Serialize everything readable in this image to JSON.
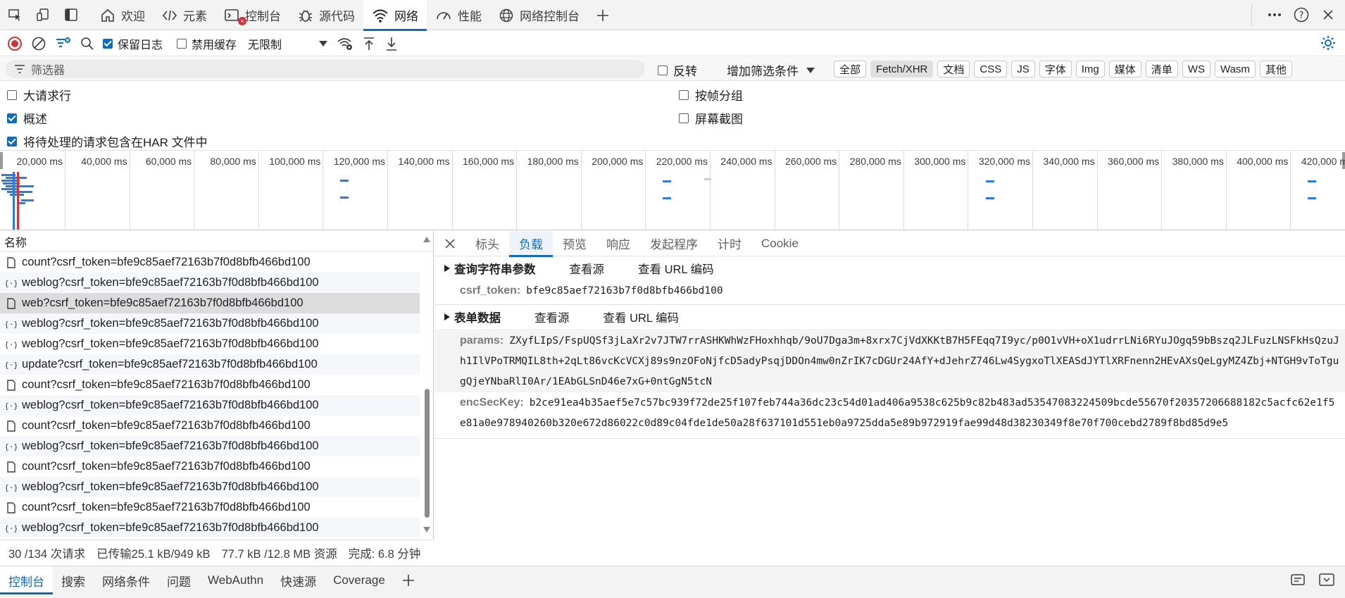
{
  "tabs": [
    {
      "label": "欢迎",
      "icon": "home-icon"
    },
    {
      "label": "元素",
      "icon": "code-icon"
    },
    {
      "label": "控制台",
      "icon": "console-icon",
      "badge": "×"
    },
    {
      "label": "源代码",
      "icon": "bug-icon"
    },
    {
      "label": "网络",
      "icon": "wifi-icon",
      "active": true
    },
    {
      "label": "性能",
      "icon": "gauge-icon"
    },
    {
      "label": "网络控制台",
      "icon": "globe-icon"
    }
  ],
  "toolbar": {
    "preserve_log": "保留日志",
    "disable_cache": "禁用缓存",
    "throttle": "无限制"
  },
  "filter": {
    "placeholder": "筛选器",
    "invert": "反转",
    "add_filter": "增加筛选条件",
    "types": [
      "全部",
      "Fetch/XHR",
      "文档",
      "CSS",
      "JS",
      "字体",
      "Img",
      "媒体",
      "清单",
      "WS",
      "Wasm",
      "其他"
    ]
  },
  "options": {
    "big_rows": "大请求行",
    "overview": "概述",
    "har_pending": "将待处理的请求包含在HAR 文件中",
    "group_by_frame": "按帧分组",
    "screenshots": "屏幕截图"
  },
  "timeline": {
    "ticks": [
      "20,000 ms",
      "40,000 ms",
      "60,000 ms",
      "80,000 ms",
      "100,000 ms",
      "120,000 ms",
      "140,000 ms",
      "160,000 ms",
      "180,000 ms",
      "200,000 ms",
      "220,000 ms",
      "240,000 ms",
      "260,000 ms",
      "280,000 ms",
      "300,000 ms",
      "320,000 ms",
      "340,000 ms",
      "360,000 ms",
      "380,000 ms",
      "400,000 ms",
      "420,000 ms"
    ]
  },
  "requests": {
    "header": "名称",
    "rows": [
      {
        "name": "count?csrf_token=bfe9c85aef72163b7f0d8bfb466bd100",
        "icon": "doc-icon"
      },
      {
        "name": "weblog?csrf_token=bfe9c85aef72163b7f0d8bfb466bd100",
        "icon": "braces-icon"
      },
      {
        "name": "web?csrf_token=bfe9c85aef72163b7f0d8bfb466bd100",
        "icon": "doc-icon",
        "selected": true
      },
      {
        "name": "weblog?csrf_token=bfe9c85aef72163b7f0d8bfb466bd100",
        "icon": "braces-icon"
      },
      {
        "name": "weblog?csrf_token=bfe9c85aef72163b7f0d8bfb466bd100",
        "icon": "braces-icon"
      },
      {
        "name": "update?csrf_token=bfe9c85aef72163b7f0d8bfb466bd100",
        "icon": "braces-icon"
      },
      {
        "name": "count?csrf_token=bfe9c85aef72163b7f0d8bfb466bd100",
        "icon": "doc-icon"
      },
      {
        "name": "weblog?csrf_token=bfe9c85aef72163b7f0d8bfb466bd100",
        "icon": "braces-icon"
      },
      {
        "name": "count?csrf_token=bfe9c85aef72163b7f0d8bfb466bd100",
        "icon": "doc-icon"
      },
      {
        "name": "weblog?csrf_token=bfe9c85aef72163b7f0d8bfb466bd100",
        "icon": "braces-icon"
      },
      {
        "name": "count?csrf_token=bfe9c85aef72163b7f0d8bfb466bd100",
        "icon": "doc-icon"
      },
      {
        "name": "weblog?csrf_token=bfe9c85aef72163b7f0d8bfb466bd100",
        "icon": "braces-icon"
      },
      {
        "name": "count?csrf_token=bfe9c85aef72163b7f0d8bfb466bd100",
        "icon": "doc-icon"
      },
      {
        "name": "weblog?csrf_token=bfe9c85aef72163b7f0d8bfb466bd100",
        "icon": "braces-icon"
      }
    ]
  },
  "details": {
    "tabs": [
      "标头",
      "负载",
      "预览",
      "响应",
      "发起程序",
      "计时",
      "Cookie"
    ],
    "active_tab": "负载",
    "query": {
      "title": "查询字符串参数",
      "view_source": "查看源",
      "view_url_encoded": "查看 URL 编码",
      "key": "csrf_token:",
      "value": "bfe9c85aef72163b7f0d8bfb466bd100"
    },
    "form": {
      "title": "表单数据",
      "view_source": "查看源",
      "view_url_encoded": "查看 URL 编码",
      "params_key": "params:",
      "params_value": "ZXyfLIpS/FspUQSf3jLaXr2v7JTW7rrASHKWhWzFHoxhhqb/9oU7Dga3m+8xrx7CjVdXKKtB7H5FEqq7I9yc/p0O1vVH+oX1udrrLNi6RYuJOgq59bBszq2JLFuzLNSFkHsQzuJh1IlVPoTRMQIL8th+2qLt86vcKcVCXj89s9nzOFoNjfcD5adyPsqjDDOn4mw0nZrIK7cDGUr24AfY+dJehrZ746Lw4SygxoTlXEASdJYTlXRFnenn2HEvAXsQeLgyMZ4Zbj+NTGH9vToTgugQjeYNbaRlI0Ar/1EAbGLSnD46e7xG+0ntGgN5tcN",
      "enc_key": "encSecKey:",
      "enc_value": "b2ce91ea4b35aef5e7c57bc939f72de25f107feb744a36dc23c54d01ad406a9538c625b9c82b483ad53547083224509bcde55670f20357206688182c5acfc62e1f5e81a0e978940260b320e672d86022c0d89c04fde1de50a28f637101d551eb0a9725dda5e89b972919fae99d48d38230349f8e70f700cebd2789f8bd85d9e5"
    }
  },
  "status": {
    "requests": "30 /134 次请求",
    "transferred": "已传输25.1 kB/949 kB",
    "resources": "77.7 kB /12.8 MB 资源",
    "finish": "完成: 6.8 分钟"
  },
  "drawer": {
    "tabs": [
      "控制台",
      "搜索",
      "网络条件",
      "问题",
      "WebAuthn",
      "快速源",
      "Coverage"
    ]
  },
  "colors": {
    "accent": "#0f6cbd",
    "record": "#d13438",
    "bar": "#2d7ae1"
  }
}
